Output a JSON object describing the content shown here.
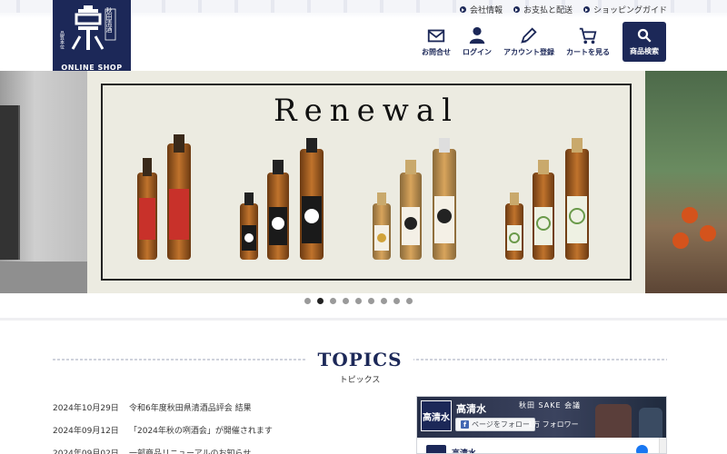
{
  "logo": {
    "brand_vertical": "秋田清酒",
    "brand_text": "ONLINE SHOP",
    "mark_text": "高清水",
    "color": "#1c2858"
  },
  "utility_links": [
    {
      "label": "会社情報",
      "icon": "chevron-right-icon"
    },
    {
      "label": "お支払と配送",
      "icon": "chevron-right-icon"
    },
    {
      "label": "ショッピングガイド",
      "icon": "chevron-right-icon"
    }
  ],
  "nav": [
    {
      "label": "お問合せ",
      "icon": "envelope-icon"
    },
    {
      "label": "ログイン",
      "icon": "user-icon"
    },
    {
      "label": "アカウント登録",
      "icon": "pencil-icon"
    },
    {
      "label": "カートを見る",
      "icon": "cart-icon"
    }
  ],
  "search_button": {
    "label": "商品検索",
    "icon": "search-icon"
  },
  "hero": {
    "slide_title": "Renewal",
    "dots_count": 9,
    "active_dot": 1
  },
  "topics": {
    "title": "TOPICS",
    "subtitle": "トピックス",
    "items": [
      {
        "date": "2024年10月29日",
        "title": "令和6年度秋田県清酒品評会 結果"
      },
      {
        "date": "2024年09月12日",
        "title": "「2024年秋の咧酒会」が開催されます"
      },
      {
        "date": "2024年09月02日",
        "title": "一部商品リニューアルのお知らせ"
      }
    ]
  },
  "facebook_widget": {
    "page_name": "高清水",
    "avatar_text": "高清水",
    "banner_text": "秋田 SAKE 会議",
    "follow_label": "ページをフォロー",
    "followers": "1万 フォロワー",
    "post_author": "高清水"
  },
  "colors": {
    "brand": "#1c2858",
    "facebook": "#1877f2"
  }
}
